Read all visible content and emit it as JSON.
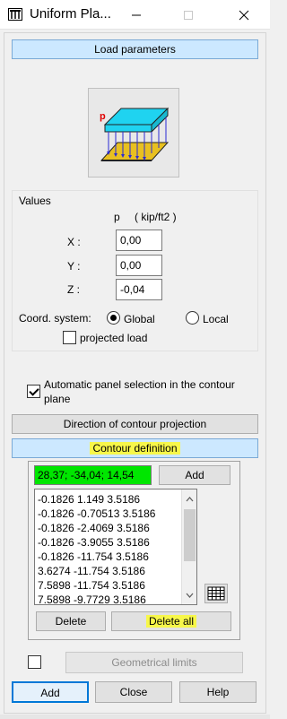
{
  "window": {
    "title": "Uniform Pla..."
  },
  "buttons": {
    "load_parameters": "Load parameters",
    "direction_projection": "Direction of contour projection",
    "contour_definition": "Contour definition",
    "add_point": "Add",
    "delete": "Delete",
    "delete_all": "Delete all",
    "geometrical_limits": "Geometrical limits",
    "add": "Add",
    "close": "Close",
    "help": "Help"
  },
  "values": {
    "heading": "Values",
    "column_label": "p",
    "unit": "( kip/ft2 )",
    "x_label": "X :",
    "x_value": "0,00",
    "y_label": "Y :",
    "y_value": "0,00",
    "z_label": "Z :",
    "z_value": "-0,04"
  },
  "coord": {
    "label": "Coord. system:",
    "global": "Global",
    "local": "Local",
    "selected": "Global",
    "projected_load": "projected load",
    "projected_checked": false
  },
  "automatic_panel": {
    "line1": "Automatic panel selection in the contour",
    "line2": "plane",
    "checked": true
  },
  "contour": {
    "current_point": "28,37; -34,04; 14,54",
    "points": [
      "-0.1826 1.149 3.5186",
      "-0.1826 -0.70513 3.5186",
      "-0.1826 -2.4069 3.5186",
      "-0.1826 -3.9055 3.5186",
      "-0.1826 -11.754 3.5186",
      "3.6274 -11.754 3.5186",
      "7.5898 -11.754 3.5186",
      "7.5898 -9.7729 3.5186"
    ]
  },
  "geometrical_limits_checked": false,
  "colors": {
    "highlight": "#f7f74a",
    "current_point_bg": "#00e600",
    "accent_button": "#cce8ff",
    "plate_top": "#1fd3f0",
    "load_arrows": "#2a2ad4",
    "support": "#e8c020",
    "load_label": "#e00000"
  },
  "icons": [
    "app-icon",
    "minimize-icon",
    "maximize-icon",
    "close-icon",
    "plate-load-illustration",
    "table-icon",
    "scroll-up-icon",
    "scroll-down-icon"
  ]
}
